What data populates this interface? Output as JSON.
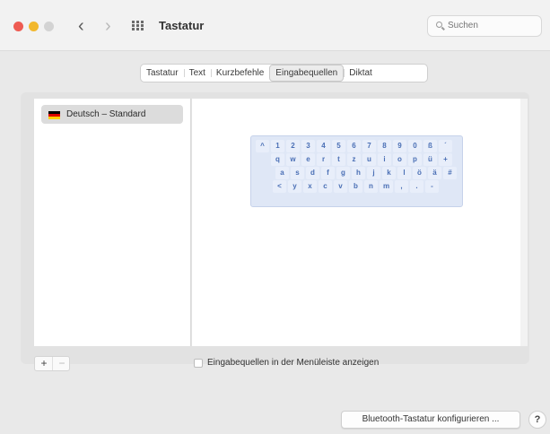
{
  "window": {
    "title": "Tastatur",
    "search_placeholder": "Suchen"
  },
  "tabs": [
    {
      "label": "Tastatur",
      "active": false
    },
    {
      "label": "Text",
      "active": false
    },
    {
      "label": "Kurzbefehle",
      "active": false
    },
    {
      "label": "Eingabequellen",
      "active": true
    },
    {
      "label": "Diktat",
      "active": false
    }
  ],
  "sources": [
    {
      "label": "Deutsch – Standard",
      "flag_colors": [
        "#000000",
        "#dd0000",
        "#ffce00"
      ]
    }
  ],
  "keyboard": {
    "rows": [
      [
        "^",
        "1",
        "2",
        "3",
        "4",
        "5",
        "6",
        "7",
        "8",
        "9",
        "0",
        "ß",
        "´"
      ],
      [
        "q",
        "w",
        "e",
        "r",
        "t",
        "z",
        "u",
        "i",
        "o",
        "p",
        "ü",
        "+"
      ],
      [
        "a",
        "s",
        "d",
        "f",
        "g",
        "h",
        "j",
        "k",
        "l",
        "ö",
        "ä",
        "#"
      ],
      [
        "<",
        "y",
        "x",
        "c",
        "v",
        "b",
        "n",
        "m",
        ",",
        ".",
        "-"
      ]
    ]
  },
  "controls": {
    "add_label": "+",
    "remove_label": "−",
    "show_in_menubar_label": "Eingabequellen in der Menüleiste anzeigen",
    "show_in_menubar_checked": false,
    "bluetooth_button": "Bluetooth-Tastatur konfigurieren ...",
    "help_button": "?"
  },
  "colors": {
    "close": "#ee5b52",
    "minimize": "#f2b82e",
    "zoom": "#d3d3d3",
    "key_text": "#4a6fb5"
  }
}
